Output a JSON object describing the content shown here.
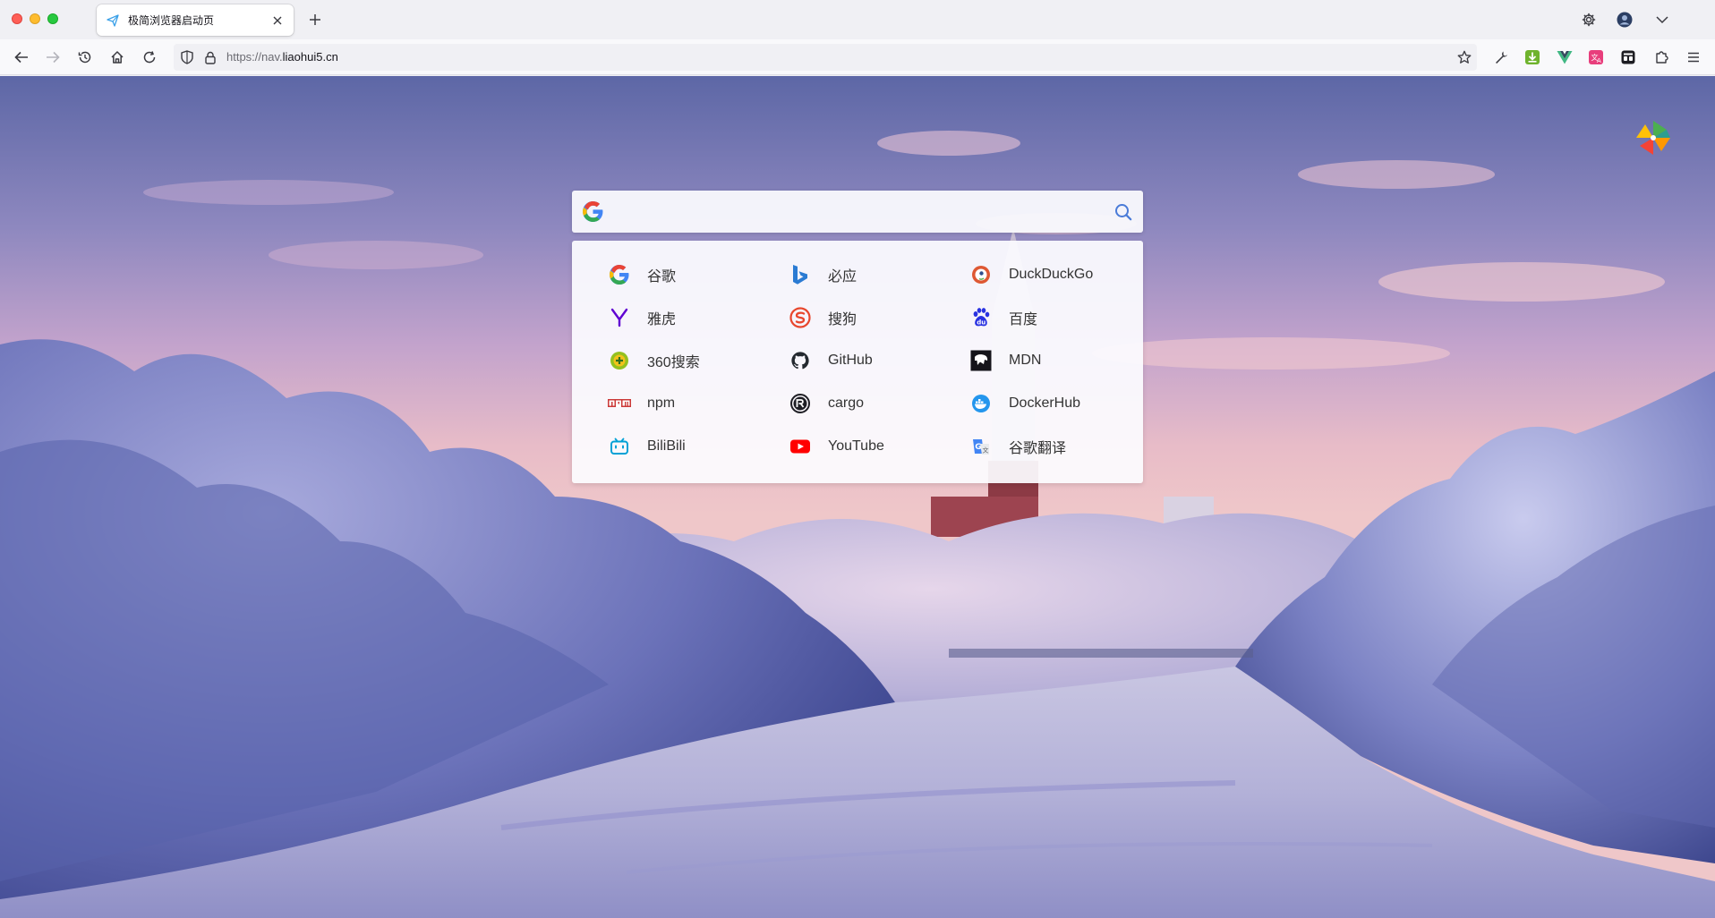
{
  "browser": {
    "tab": {
      "title": "极简浏览器启动页",
      "close_icon": "close-icon",
      "favicon": "paper-plane-icon"
    },
    "new_tab_label": "+",
    "url": {
      "scheme": "https://nav.",
      "host": "liaohui5.cn"
    }
  },
  "search": {
    "placeholder": "",
    "engine_icon": "google-g-icon",
    "submit_icon": "search-icon",
    "accent": "#4a7bd8"
  },
  "engines": [
    {
      "label": "谷歌",
      "icon": "google"
    },
    {
      "label": "必应",
      "icon": "bing"
    },
    {
      "label": "DuckDuckGo",
      "icon": "duckduckgo"
    },
    {
      "label": "雅虎",
      "icon": "yahoo"
    },
    {
      "label": "搜狗",
      "icon": "sogou"
    },
    {
      "label": "百度",
      "icon": "baidu"
    },
    {
      "label": "360搜索",
      "icon": "so360"
    },
    {
      "label": "GitHub",
      "icon": "github"
    },
    {
      "label": "MDN",
      "icon": "mdn"
    },
    {
      "label": "npm",
      "icon": "npm"
    },
    {
      "label": "cargo",
      "icon": "cargo"
    },
    {
      "label": "DockerHub",
      "icon": "docker"
    },
    {
      "label": "BiliBili",
      "icon": "bilibili"
    },
    {
      "label": "YouTube",
      "icon": "youtube"
    },
    {
      "label": "谷歌翻译",
      "icon": "translate"
    }
  ],
  "colors": {
    "google_blue": "#4285f4",
    "google_red": "#ea4335",
    "google_yellow": "#fbbc05",
    "google_green": "#34a853",
    "bing": "#2b7bd3",
    "duckduckgo": "#de5833",
    "yahoo": "#6001d2",
    "sogou": "#e8472d",
    "baidu": "#2932e1",
    "so360": "#94c11f",
    "github": "#24292f",
    "npm": "#cb3837",
    "docker": "#2496ed",
    "bilibili": "#00a1d6",
    "youtube": "#ff0000"
  }
}
